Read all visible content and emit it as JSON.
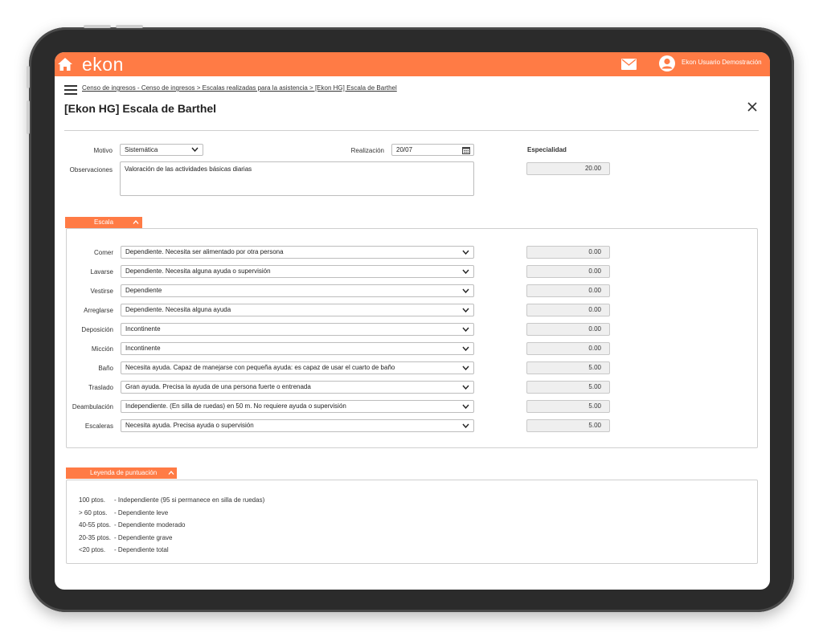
{
  "header": {
    "logo": "ekon",
    "user_name": "Ekon Usuario Demostración",
    "accent_color": "#ff7b45"
  },
  "breadcrumb": "Censo de ingresos - Censo de ingresos > Escalas realizadas para la asistencia > [Ekon HG] Escala de Barthel",
  "page_title": "[Ekon HG] Escala de Barthel",
  "form": {
    "motivo_label": "Motivo",
    "motivo_value": "Sistemática",
    "realizacion_label": "Realización",
    "realizacion_value": "20/07",
    "observaciones_label": "Observaciones",
    "observaciones_value": "Valoración de las actividades básicas diarias",
    "especialidad_label": "Especialidad",
    "especialidad_value": "20.00"
  },
  "escala": {
    "tab_label": "Escala",
    "items": [
      {
        "label": "Comer",
        "value": "Dependiente. Necesita ser alimentado por otra persona",
        "score": "0.00"
      },
      {
        "label": "Lavarse",
        "value": "Dependiente. Necesita alguna ayuda o supervisión",
        "score": "0.00"
      },
      {
        "label": "Vestirse",
        "value": "Dependiente",
        "score": "0.00"
      },
      {
        "label": "Arreglarse",
        "value": "Dependiente. Necesita alguna ayuda",
        "score": "0.00"
      },
      {
        "label": "Deposición",
        "value": "Incontinente",
        "score": "0.00"
      },
      {
        "label": "Micción",
        "value": "Incontinente",
        "score": "0.00"
      },
      {
        "label": "Baño",
        "value": "Necesita ayuda. Capaz de manejarse con pequeña ayuda: es capaz de usar el cuarto de baño",
        "score": "5.00"
      },
      {
        "label": "Traslado",
        "value": "Gran ayuda. Precisa la ayuda de una persona fuerte o entrenada",
        "score": "5.00"
      },
      {
        "label": "Deambulación",
        "value": "Independiente. (En silla de ruedas) en 50 m. No requiere ayuda o supervisión",
        "score": "5.00"
      },
      {
        "label": "Escaleras",
        "value": "Necesita ayuda. Precisa ayuda o supervisión",
        "score": "5.00"
      }
    ]
  },
  "leyenda": {
    "tab_label": "Leyenda de puntuación",
    "lines": [
      {
        "pts": "100 ptos.",
        "desc": "- Independiente (95 si permanece en silla de ruedas)"
      },
      {
        "pts": "> 60 ptos.",
        "desc": "- Dependiente leve"
      },
      {
        "pts": "40-55 ptos.",
        "desc": "- Dependiente moderado"
      },
      {
        "pts": "20-35 ptos.",
        "desc": "- Dependiente grave"
      },
      {
        "pts": "<20 ptos.",
        "desc": "- Dependiente total"
      }
    ]
  }
}
